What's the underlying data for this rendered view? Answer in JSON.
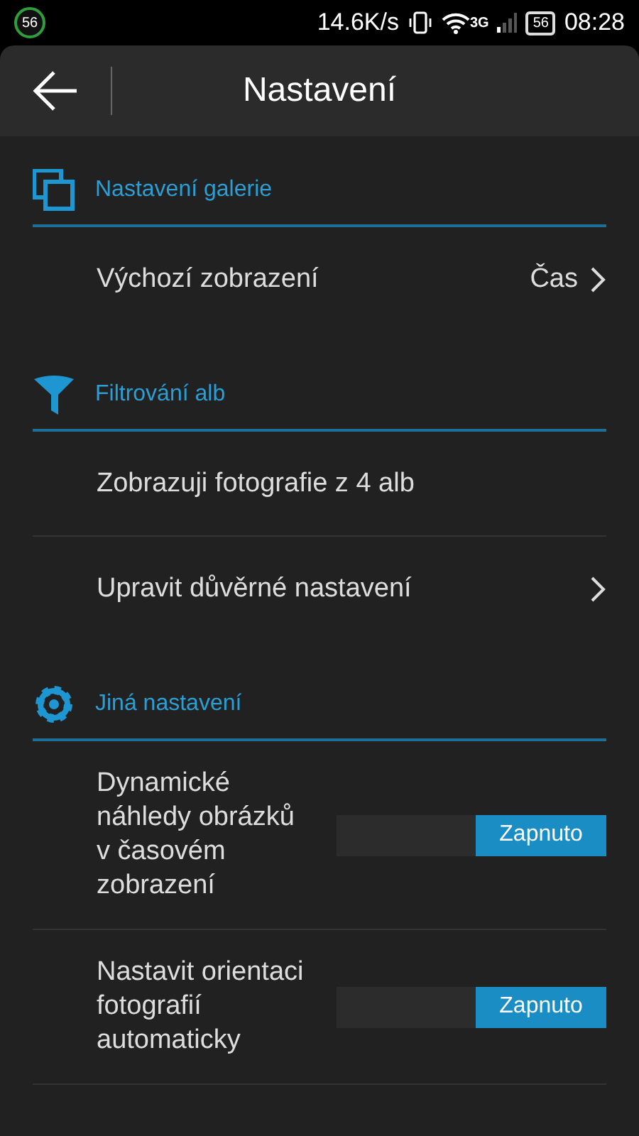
{
  "status_bar": {
    "badge": "56",
    "speed": "14.6K/s",
    "network": "3G",
    "battery": "56",
    "time": "08:28"
  },
  "header": {
    "title": "Nastavení"
  },
  "sections": [
    {
      "kind": "gallery",
      "title": "Nastavení galerie",
      "items": [
        {
          "kind": "value",
          "label": "Výchozí zobrazení",
          "value": "Čas"
        }
      ]
    },
    {
      "kind": "filter",
      "title": "Filtrování alb",
      "items": [
        {
          "kind": "plain",
          "label": "Zobrazuji fotografie z 4 alb"
        },
        {
          "kind": "link",
          "label": "Upravit důvěrné nastavení"
        }
      ]
    },
    {
      "kind": "gear",
      "title": "Jiná nastavení",
      "items": [
        {
          "kind": "toggle",
          "label": "Dynamické náhledy obrázků v časovém zobrazení",
          "state": "Zapnuto",
          "on": true
        },
        {
          "kind": "toggle",
          "label": "Nastavit orientaci fotografií automaticky",
          "state": "Zapnuto",
          "on": true
        }
      ]
    }
  ]
}
